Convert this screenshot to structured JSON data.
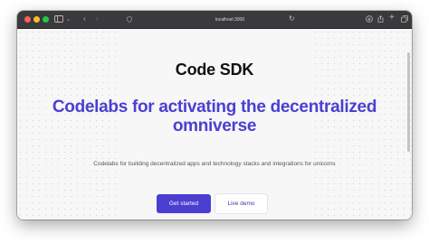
{
  "browser": {
    "url": "localhost:3000",
    "traffic_lights": {
      "close": "#ff5f57",
      "minimize": "#febc2e",
      "maximize": "#28c840"
    }
  },
  "page": {
    "brand": "Code SDK",
    "headline": "Codelabs for activating the decentralized omniverse",
    "subtitle": "Codelabs for building decentralized apps and technology stacks and integrations for unicorns",
    "primary_button": "Get started",
    "secondary_button": "Live demo",
    "accent_color": "#4a3fd1"
  }
}
